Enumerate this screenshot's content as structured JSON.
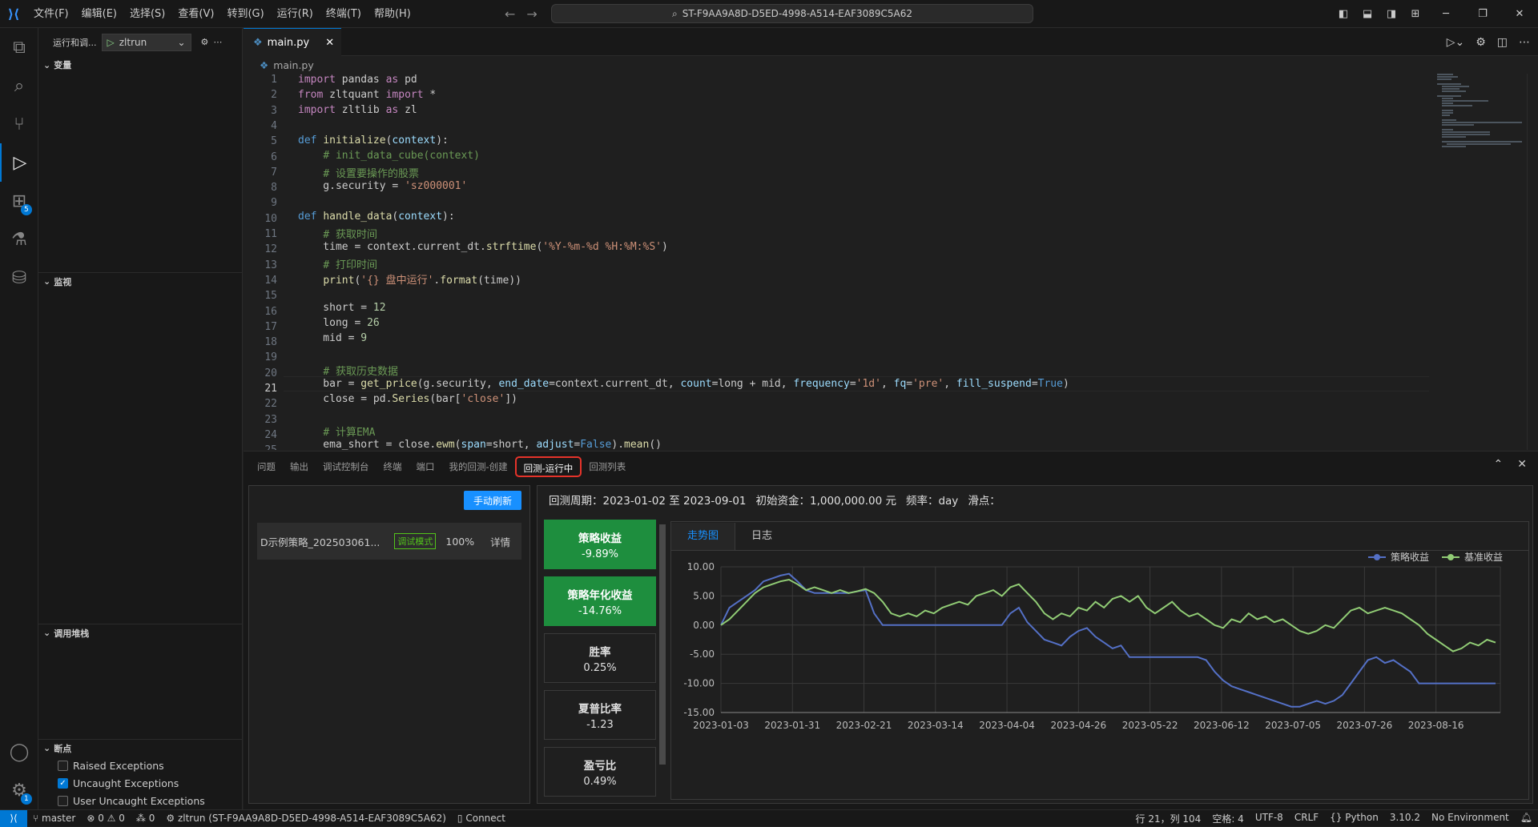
{
  "titlebar": {
    "menu": [
      "文件(F)",
      "编辑(E)",
      "选择(S)",
      "查看(V)",
      "转到(G)",
      "运行(R)",
      "终端(T)",
      "帮助(H)"
    ],
    "search": "ST-F9AA9A8D-D5ED-4998-A514-EAF3089C5A62"
  },
  "activity": {
    "extensions_badge": "5",
    "settings_badge": "1"
  },
  "sidebar": {
    "title": "运行和调...",
    "run_config": "zltrun",
    "sections": {
      "variables": "变量",
      "watch": "监视",
      "callstack": "调用堆栈",
      "breakpoints": "断点"
    },
    "breakpoints": [
      {
        "label": "Raised Exceptions",
        "checked": false
      },
      {
        "label": "Uncaught Exceptions",
        "checked": true
      },
      {
        "label": "User Uncaught Exceptions",
        "checked": false
      }
    ]
  },
  "editor": {
    "tab": "main.py",
    "breadcrumb": "main.py",
    "line_numbers": [
      "1",
      "2",
      "3",
      "4",
      "5",
      "6",
      "7",
      "8",
      "9",
      "10",
      "11",
      "12",
      "13",
      "14",
      "15",
      "16",
      "17",
      "18",
      "19",
      "20",
      "21",
      "22",
      "23",
      "24",
      "25"
    ]
  },
  "panel": {
    "tabs": [
      "问题",
      "输出",
      "调试控制台",
      "终端",
      "端口",
      "我的回测-创建",
      "回测-运行中",
      "回测列表"
    ],
    "refresh_button": "手动刷新",
    "strategy": {
      "name": "D示例策略_202503061...",
      "mode": "调试模式",
      "progress": "100%",
      "detail": "详情"
    },
    "info": {
      "period": "回测周期：2023-01-02 至 2023-09-01",
      "capital": "初始资金：1,000,000.00 元",
      "freq": "频率：day",
      "slippage": "滑点："
    },
    "stats": [
      {
        "label": "策略收益",
        "value": "-9.89%",
        "highlight": true
      },
      {
        "label": "策略年化收益",
        "value": "-14.76%",
        "highlight": true
      },
      {
        "label": "胜率",
        "value": "0.25%",
        "highlight": false
      },
      {
        "label": "夏普比率",
        "value": "-1.23",
        "highlight": false
      },
      {
        "label": "盈亏比",
        "value": "0.49%",
        "highlight": false
      }
    ],
    "chart_tabs": [
      "走势图",
      "日志"
    ]
  },
  "status": {
    "branch": "master",
    "problems": "0",
    "warnings": "0",
    "ports": "0",
    "run": "zltrun (ST-F9AA9A8D-D5ED-4998-A514-EAF3089C5A62)",
    "connect": "Connect",
    "position": "行 21，列 104",
    "spaces": "空格: 4",
    "encoding": "UTF-8",
    "eol": "CRLF",
    "language": "Python",
    "version": "3.10.2",
    "env": "No Environment"
  },
  "chart_data": {
    "type": "line",
    "x_ticks": [
      "2023-01-03",
      "2023-01-31",
      "2023-02-21",
      "2023-03-14",
      "2023-04-04",
      "2023-04-26",
      "2023-05-22",
      "2023-06-12",
      "2023-07-05",
      "2023-07-26",
      "2023-08-16"
    ],
    "y_ticks": [
      "10.00",
      "5.00",
      "0.00",
      "-5.00",
      "-10.00",
      "-15.00"
    ],
    "ylim": [
      -15,
      10
    ],
    "legend": "top-right",
    "series": [
      {
        "name": "策略收益",
        "color": "#5470c6",
        "values": [
          0,
          3,
          4,
          5,
          6,
          7.5,
          8,
          8.5,
          8.8,
          7.5,
          6,
          5.5,
          5.5,
          5.5,
          5.5,
          5.5,
          5.8,
          6,
          2,
          0,
          0,
          0,
          0,
          0,
          0,
          0,
          0,
          0,
          0,
          0,
          0,
          0,
          0,
          0,
          2,
          3,
          0.5,
          -1,
          -2.5,
          -3,
          -3.5,
          -2,
          -1,
          -0.5,
          -2,
          -3,
          -4,
          -3.5,
          -5.5,
          -5.5,
          -5.5,
          -5.5,
          -5.5,
          -5.5,
          -5.5,
          -5.5,
          -5.5,
          -6,
          -8,
          -9.5,
          -10.5,
          -11,
          -11.5,
          -12,
          -12.5,
          -13,
          -13.5,
          -14,
          -14,
          -13.5,
          -13,
          -13.5,
          -13,
          -12,
          -10,
          -8,
          -6,
          -5.5,
          -6.5,
          -6,
          -7,
          -8,
          -10,
          -10,
          -10,
          -10,
          -10,
          -10,
          -10,
          -10,
          -10,
          -10
        ]
      },
      {
        "name": "基准收益",
        "color": "#91cc75",
        "values": [
          0,
          1,
          2.5,
          4,
          5.5,
          6.5,
          7,
          7.5,
          7.8,
          7,
          6,
          6.5,
          6,
          5.5,
          6,
          5.5,
          5.8,
          6.2,
          5.5,
          4,
          2,
          1.5,
          2,
          1.5,
          2.5,
          2,
          3,
          3.5,
          4,
          3.5,
          5,
          5.5,
          6,
          5,
          6.5,
          7,
          5.5,
          4,
          2,
          1,
          2,
          1.5,
          3,
          2.5,
          4,
          3,
          4.5,
          5,
          4,
          5,
          3,
          2,
          3,
          4,
          2.5,
          1.5,
          2,
          1,
          0,
          -0.5,
          1,
          0.5,
          2,
          1,
          1.5,
          0.5,
          1,
          0,
          -1,
          -1.5,
          -1,
          0,
          -0.5,
          1,
          2.5,
          3,
          2,
          2.5,
          3,
          2.5,
          2,
          1,
          0,
          -1.5,
          -2.5,
          -3.5,
          -4.5,
          -4,
          -3,
          -3.5,
          -2.5,
          -3
        ]
      }
    ]
  }
}
